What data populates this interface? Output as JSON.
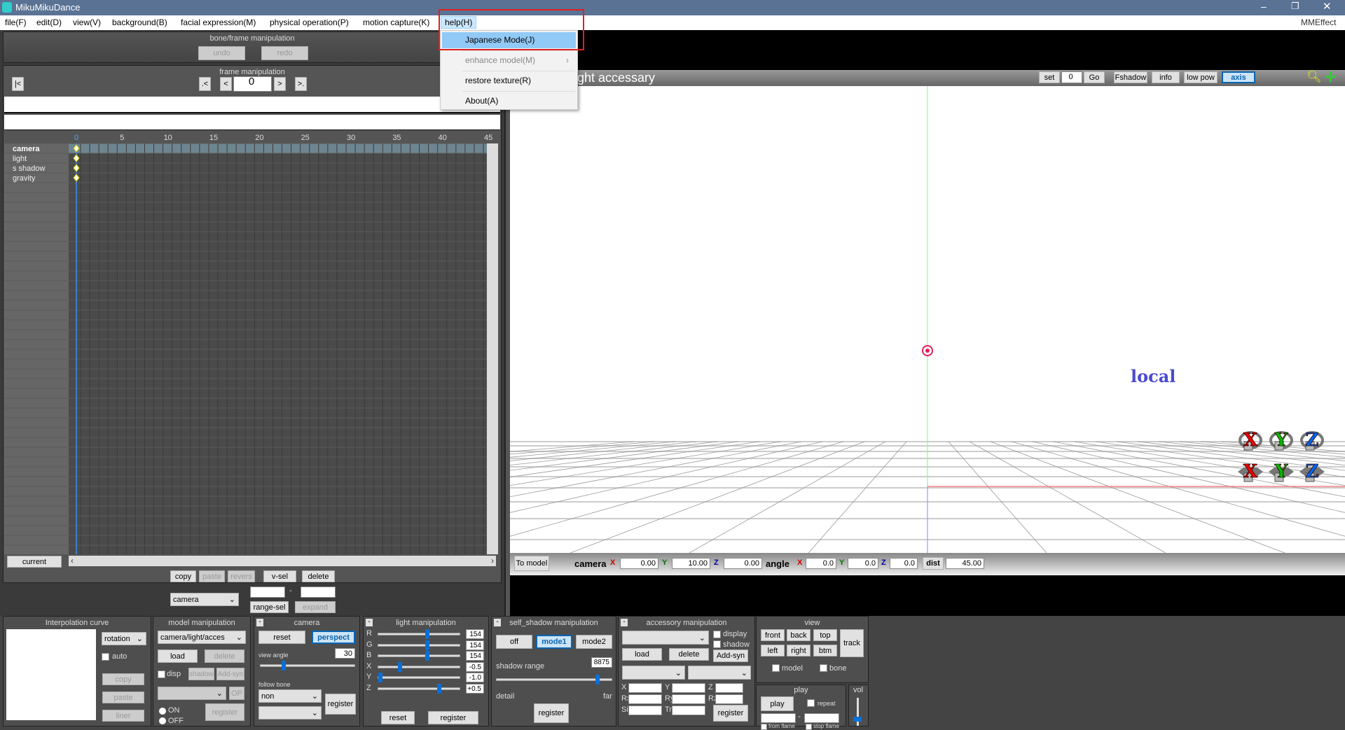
{
  "app": {
    "title": "MikuMikuDance",
    "right_menu": "MMEffect"
  },
  "menu": [
    "file(F)",
    "edit(D)",
    "view(V)",
    "background(B)",
    "facial expression(M)",
    "physical operation(P)",
    "motion capture(K)",
    "help(H)"
  ],
  "help_menu": {
    "items": [
      {
        "label": "Japanese Mode(J)",
        "highlighted": true
      },
      {
        "label": "enhance model(M)",
        "disabled": true,
        "submenu": true
      },
      {
        "label": "restore texture(R)"
      },
      {
        "label": "About(A)"
      }
    ]
  },
  "bone_frame": {
    "title": "bone/frame manipulation",
    "undo": "undo",
    "redo": "redo"
  },
  "frame_manip": {
    "title": "frame manipulation",
    "frame": "0"
  },
  "timeline": {
    "ticks": [
      "0",
      "5",
      "10",
      "15",
      "20",
      "25",
      "30",
      "35",
      "40",
      "45"
    ],
    "rows": [
      "camera",
      "light",
      "s shadow",
      "gravity"
    ],
    "current": "current"
  },
  "frame_ops": {
    "copy": "copy",
    "paste": "paste",
    "revers": "revers",
    "vsel": "v-sel",
    "delete": "delete",
    "target": "camera",
    "dash": "-",
    "range_sel": "range-sel",
    "expand": "expand"
  },
  "viewport": {
    "title": "ght accessary",
    "set": "set",
    "frame": "0",
    "go": "Go",
    "fshadow": "Fshadow",
    "info": "info",
    "lowpow": "low pow",
    "axis": "axis",
    "local": "local",
    "axis_letters": [
      "X",
      "Y",
      "Z"
    ]
  },
  "camera_bar": {
    "to_model": "To model",
    "camera": "camera",
    "angle": "angle",
    "dist": "dist",
    "x": "X",
    "y": "Y",
    "z": "Z",
    "cx": "0.00",
    "cy": "10.00",
    "cz": "0.00",
    "ax": "0.0",
    "ay": "0.0",
    "az": "0.0",
    "distv": "45.00"
  },
  "interp": {
    "title": "Interpolation curve",
    "mode": "rotation",
    "auto": "auto",
    "copy": "copy",
    "paste": "paste",
    "liner": "liner"
  },
  "model": {
    "title": "model manipulation",
    "target": "camera/light/acces",
    "load": "load",
    "delete": "delete",
    "disp": "disp",
    "shadow": "shadow",
    "addsyn": "Add-syn",
    "op": "OP",
    "on": "ON",
    "off": "OFF",
    "register": "register"
  },
  "camera": {
    "title": "camera",
    "reset": "reset",
    "perspect": "perspect",
    "view_angle": "view angle",
    "angle": "30",
    "follow_bone": "follow bone",
    "bone": "non",
    "register": "register"
  },
  "light": {
    "title": "light manipulation",
    "rows": [
      {
        "k": "R",
        "v": "154",
        "p": 0.6
      },
      {
        "k": "G",
        "v": "154",
        "p": 0.6
      },
      {
        "k": "B",
        "v": "154",
        "p": 0.6
      },
      {
        "k": "X",
        "v": "-0.5",
        "p": 0.25
      },
      {
        "k": "Y",
        "v": "-1.0",
        "p": 0
      },
      {
        "k": "Z",
        "v": "+0.5",
        "p": 0.75
      }
    ],
    "reset": "reset",
    "register": "register"
  },
  "self_shadow": {
    "title": "self_shadow manipulation",
    "off": "off",
    "mode1": "mode1",
    "mode2": "mode2",
    "range_label": "shadow range",
    "range": "8875",
    "range_pos": 0.88,
    "detail": "detail",
    "far": "far",
    "register": "register"
  },
  "accessory": {
    "title": "accessory manipulation",
    "display": "display",
    "shadow": "shadow",
    "load": "load",
    "delete": "delete",
    "addsyn": "Add-syn",
    "labels": [
      "X",
      "Y",
      "Z",
      "Rx",
      "Ry",
      "Rz",
      "Si",
      "Tr"
    ],
    "register": "register"
  },
  "view": {
    "title": "view",
    "front": "front",
    "back": "back",
    "top": "top",
    "track": "track",
    "left": "left",
    "right": "right",
    "btm": "btm",
    "model": "model",
    "bone": "bone"
  },
  "play": {
    "title": "play",
    "play": "play",
    "repeat": "repeat",
    "dash": "-",
    "from": "from flame",
    "stop": "stop flame"
  },
  "vol": {
    "title": "vol",
    "level": 0.2
  },
  "colors": {
    "accent": "#0a64b0",
    "titlebar": "#5a7294",
    "highlight": "#91c9f7"
  }
}
